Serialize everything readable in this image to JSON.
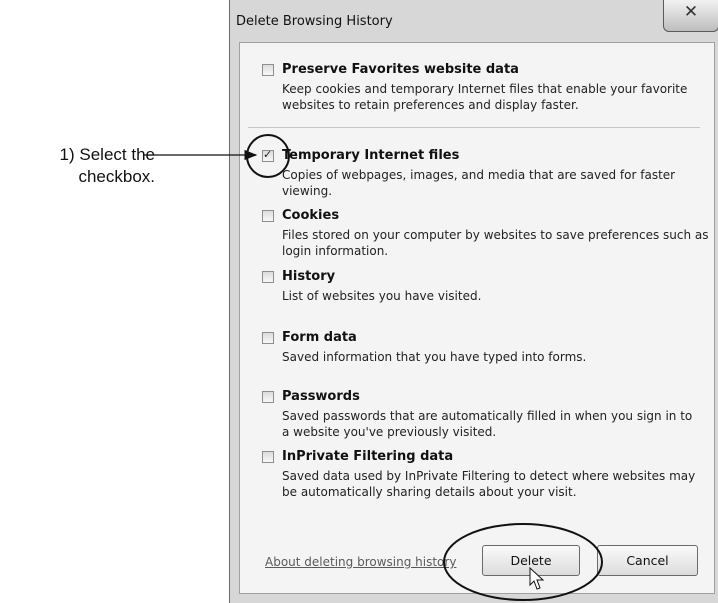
{
  "annotation": {
    "line1": "1) Select the",
    "line2": "checkbox."
  },
  "dialog": {
    "title": "Delete Browsing History",
    "close_icon": "close-icon",
    "options": [
      {
        "title": "Preserve Favorites website data",
        "desc": "Keep cookies and temporary Internet files that enable your favorite websites to retain preferences and display faster.",
        "checked": false
      },
      {
        "title": "Temporary Internet files",
        "desc": "Copies of webpages, images, and media that are saved for faster viewing.",
        "checked": true
      },
      {
        "title": "Cookies",
        "desc": "Files stored on your computer by websites to save preferences such as login information.",
        "checked": false
      },
      {
        "title": "History",
        "desc": "List of websites you have visited.",
        "checked": false
      },
      {
        "title": "Form data",
        "desc": "Saved information that you have typed into forms.",
        "checked": false
      },
      {
        "title": "Passwords",
        "desc": "Saved passwords that are automatically filled in when you sign in to a website you've previously visited.",
        "checked": false
      },
      {
        "title": "InPrivate Filtering data",
        "desc": "Saved data used by InPrivate Filtering to detect where websites may be automatically sharing details about your visit.",
        "checked": false
      }
    ],
    "about_link": "About deleting browsing history",
    "delete_label": "Delete",
    "cancel_label": "Cancel"
  }
}
